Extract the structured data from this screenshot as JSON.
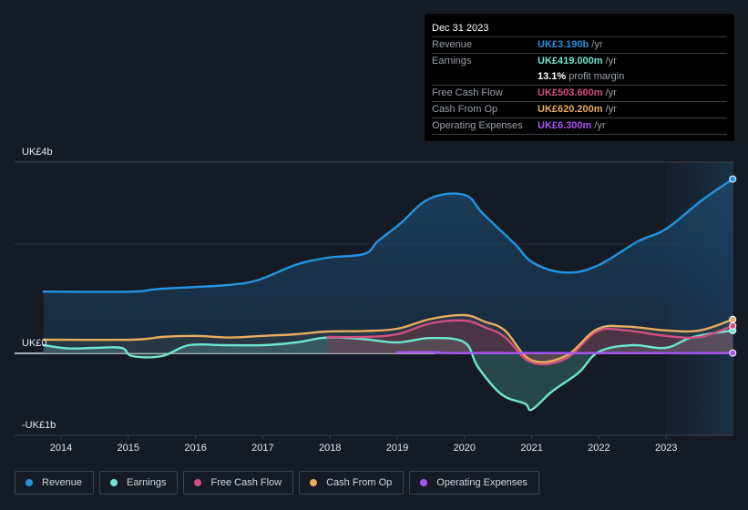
{
  "tooltip": {
    "date": "Dec 31 2023",
    "rows": [
      {
        "label": "Revenue",
        "value": "UK£3.190b",
        "unit": "/yr",
        "color": "#2394df"
      },
      {
        "label": "Earnings",
        "value": "UK£419.000m",
        "unit": "/yr",
        "color": "#6ee5d0"
      },
      {
        "label": "",
        "value": "13.1%",
        "unit": "profit margin",
        "color": "#ffffff"
      },
      {
        "label": "Free Cash Flow",
        "value": "UK£503.600m",
        "unit": "/yr",
        "color": "#d2507f"
      },
      {
        "label": "Cash From Op",
        "value": "UK£620.200m",
        "unit": "/yr",
        "color": "#e8ad5d"
      },
      {
        "label": "Operating Expenses",
        "value": "UK£6.300m",
        "unit": "/yr",
        "color": "#a855f7"
      }
    ]
  },
  "legend": [
    {
      "label": "Revenue",
      "color": "#2394df"
    },
    {
      "label": "Earnings",
      "color": "#6ee5d0"
    },
    {
      "label": "Free Cash Flow",
      "color": "#d2507f"
    },
    {
      "label": "Cash From Op",
      "color": "#e8ad5d"
    },
    {
      "label": "Operating Expenses",
      "color": "#a855f7"
    }
  ],
  "chart_data": {
    "type": "line",
    "title": "",
    "xlabel": "",
    "ylabel": "",
    "currency": "UK£",
    "y_tick_labels": [
      {
        "label": "UK£4b",
        "value": 3.5
      },
      {
        "label": "UK£0",
        "value": 0
      },
      {
        "label": "-UK£1b",
        "value": -1.5
      }
    ],
    "x_tick_labels": [
      "2014",
      "2015",
      "2016",
      "2017",
      "2018",
      "2019",
      "2020",
      "2021",
      "2022",
      "2023"
    ],
    "x_ticks": [
      2014,
      2015,
      2016,
      2017,
      2018,
      2019,
      2020,
      2021,
      2022,
      2023
    ],
    "xlim": [
      2013.74,
      2023.99
    ],
    "ylim": [
      -1.5,
      3.5
    ],
    "highlight_from": 2023.0,
    "grid": true,
    "series": [
      {
        "name": "Revenue",
        "color": "#2394df",
        "fill": true,
        "x": [
          2013.74,
          2015.06,
          2015.46,
          2016.48,
          2016.95,
          2017.49,
          2017.96,
          2018.51,
          2018.71,
          2019.05,
          2019.48,
          2020.0,
          2020.28,
          2020.75,
          2021.02,
          2021.49,
          2021.97,
          2022.58,
          2022.99,
          2023.53,
          2023.99
        ],
        "y": [
          1.13,
          1.13,
          1.18,
          1.25,
          1.35,
          1.62,
          1.75,
          1.82,
          2.05,
          2.38,
          2.83,
          2.9,
          2.55,
          2.0,
          1.66,
          1.48,
          1.6,
          2.05,
          2.27,
          2.8,
          3.19
        ]
      },
      {
        "name": "Earnings",
        "color": "#6ee5d0",
        "fill": true,
        "x": [
          2013.74,
          2014.1,
          2014.5,
          2014.9,
          2015.06,
          2015.5,
          2015.9,
          2016.4,
          2017.0,
          2017.5,
          2017.96,
          2018.5,
          2019.0,
          2019.5,
          2020.0,
          2020.2,
          2020.55,
          2020.9,
          2021.0,
          2021.3,
          2021.7,
          2022.0,
          2022.5,
          2022.99,
          2023.4,
          2023.99
        ],
        "y": [
          0.15,
          0.09,
          0.1,
          0.1,
          -0.05,
          -0.05,
          0.15,
          0.15,
          0.15,
          0.2,
          0.29,
          0.26,
          0.2,
          0.28,
          0.2,
          -0.25,
          -0.75,
          -0.92,
          -1.03,
          -0.7,
          -0.35,
          0.03,
          0.15,
          0.1,
          0.3,
          0.419
        ]
      },
      {
        "name": "Free Cash Flow",
        "color": "#d2507f",
        "fill": true,
        "x": [
          2017.96,
          2018.5,
          2019.0,
          2019.5,
          2020.0,
          2020.3,
          2020.6,
          2020.99,
          2021.5,
          2021.97,
          2022.4,
          2022.99,
          2023.5,
          2023.99
        ],
        "y": [
          0.3,
          0.3,
          0.35,
          0.55,
          0.6,
          0.48,
          0.3,
          -0.16,
          -0.1,
          0.4,
          0.42,
          0.32,
          0.3,
          0.5036
        ]
      },
      {
        "name": "Cash From Op",
        "color": "#e8ad5d",
        "fill": false,
        "x": [
          2013.74,
          2015.06,
          2015.5,
          2016.0,
          2016.5,
          2017.0,
          2017.5,
          2017.96,
          2018.5,
          2019.0,
          2019.5,
          2020.0,
          2020.3,
          2020.6,
          2020.99,
          2021.5,
          2021.97,
          2022.4,
          2022.99,
          2023.5,
          2023.99
        ],
        "y": [
          0.25,
          0.25,
          0.3,
          0.32,
          0.29,
          0.32,
          0.35,
          0.4,
          0.41,
          0.45,
          0.63,
          0.7,
          0.58,
          0.42,
          -0.12,
          -0.05,
          0.44,
          0.49,
          0.42,
          0.42,
          0.6202
        ]
      },
      {
        "name": "Operating Expenses",
        "color": "#a855f7",
        "fill": false,
        "x": [
          2019.0,
          2019.6,
          2020.0,
          2023.99
        ],
        "y": [
          0.02,
          0.02,
          0.006,
          0.0063
        ]
      }
    ]
  }
}
